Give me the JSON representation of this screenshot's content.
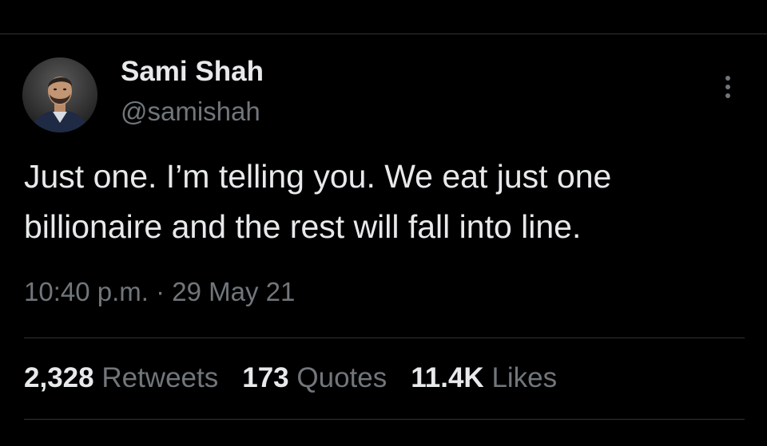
{
  "tweet": {
    "author": {
      "display_name": "Sami Shah",
      "handle": "@samishah"
    },
    "text_lines": [
      "Just one. I’m telling you. We eat just one",
      "billionaire and the rest will fall into line."
    ],
    "time": "10:40 p.m.",
    "separator": "·",
    "date": "29 May 21",
    "stats": [
      {
        "count": "2,328",
        "label": "Retweets"
      },
      {
        "count": "173",
        "label": "Quotes"
      },
      {
        "count": "11.4K",
        "label": "Likes"
      }
    ]
  },
  "icons": {
    "more": "more-vertical-icon"
  },
  "colors": {
    "background": "#000000",
    "primary_text": "#e7e9ea",
    "secondary_text": "#71767b",
    "divider": "#2f3336"
  }
}
